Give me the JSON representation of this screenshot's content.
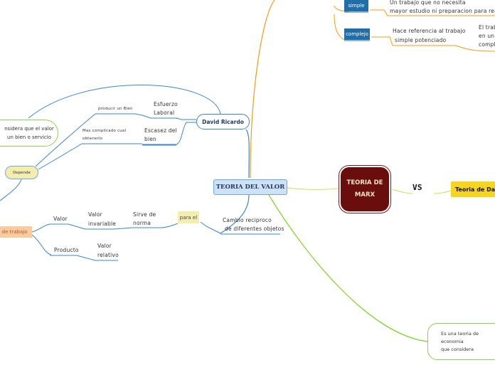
{
  "central": "TEORIA DEL VALOR",
  "marx": {
    "line1": "TEORIA DE",
    "line2": "MARX"
  },
  "us": "VS",
  "darwin": "Teoria de Da",
  "ricardo": "David Ricardo",
  "esfuerzo": {
    "line1": "Esfuerzo",
    "line2": "Laboral"
  },
  "producir": "producir un Bien",
  "escasez": {
    "line1": "Escasez del",
    "line2": "bien"
  },
  "complicado": {
    "line1": "Mas complicado cual",
    "line2": "obtenerlo"
  },
  "considera": {
    "line1": "nsidera que el valor",
    "line2": "un bien o servicio"
  },
  "depende": "Depende",
  "paraa": "para el",
  "cambio": {
    "line1": "Cambio reciproco",
    "line2": "de diferentes objetos"
  },
  "sirve": {
    "line1": "Sirve de",
    "line2": "norma"
  },
  "invariable": {
    "line1": "Valor",
    "line2": "invariable"
  },
  "valor": "Valor",
  "relativo": {
    "line1": "Valor",
    "line2": "relativo"
  },
  "producto": "Producto",
  "trabajo": "l de trabajo",
  "simple": "simple",
  "simple_text": {
    "line1": "Un trabajo que no necesita",
    "line2": "mayor estudio ni preparacion para realizars"
  },
  "complejo": "complejo",
  "complejo_text": {
    "line1": "Hace referencia al trabajo",
    "line2": "simple potenciado"
  },
  "complejo_right": {
    "line1": "El trab",
    "line2": "en un",
    "line3": "complej"
  },
  "bubble": {
    "line1": "Es una teoria de",
    "line2": "economia",
    "line3": "que considera"
  },
  "colors": {
    "blue": "#3d85c6",
    "orange": "#f39c12",
    "green": "#7ed321",
    "yellowgreen": "#c5e35a",
    "marx": "#6a0d0d"
  }
}
